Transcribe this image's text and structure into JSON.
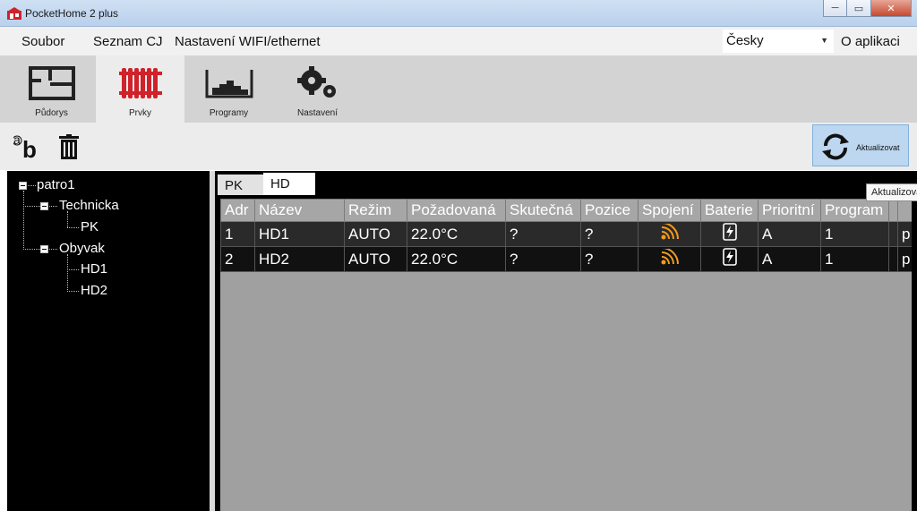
{
  "window": {
    "title": "PocketHome 2 plus",
    "minimize": "─",
    "maximize": "▭",
    "close": "✕"
  },
  "menu": {
    "file": "Soubor",
    "list": "Seznam CJ",
    "network": "Nastavení WIFI/ethernet",
    "language": "Česky",
    "about": "O aplikaci"
  },
  "ribbon": {
    "tabs": [
      {
        "label": "Půdorys",
        "icon": "floorplan-icon"
      },
      {
        "label": "Prvky",
        "icon": "radiator-icon",
        "active": true
      },
      {
        "label": "Programy",
        "icon": "programs-chart-icon"
      },
      {
        "label": "Nastavení",
        "icon": "gears-icon"
      }
    ]
  },
  "toolbar": {
    "refresh_label": "Aktualizovat",
    "tooltip": "Aktualizovat"
  },
  "tree": {
    "root": "patro1",
    "rooms": [
      {
        "name": "Technicka",
        "children": [
          "PK"
        ]
      },
      {
        "name": "Obyvak",
        "children": [
          "HD1",
          "HD2"
        ]
      }
    ]
  },
  "tabs": [
    "PK",
    "HD"
  ],
  "grid": {
    "headers": [
      "Adr",
      "Název",
      "Režim",
      "Požadovaná",
      "Skutečná",
      "Pozice",
      "Spojení",
      "Baterie",
      "Prioritní",
      "Program",
      "",
      ""
    ],
    "rows": [
      {
        "adr": "1",
        "name": "HD1",
        "mode": "AUTO",
        "target": "22.0°C",
        "actual": "?",
        "position": "?",
        "priority": "A",
        "program": "1",
        "extra": "p"
      },
      {
        "adr": "2",
        "name": "HD2",
        "mode": "AUTO",
        "target": "22.0°C",
        "actual": "?",
        "position": "?",
        "priority": "A",
        "program": "1",
        "extra": "p"
      }
    ]
  },
  "colors": {
    "accent_red": "#d0222a",
    "signal_orange": "#f39a1e",
    "selection_blue": "#bcd7ef"
  }
}
